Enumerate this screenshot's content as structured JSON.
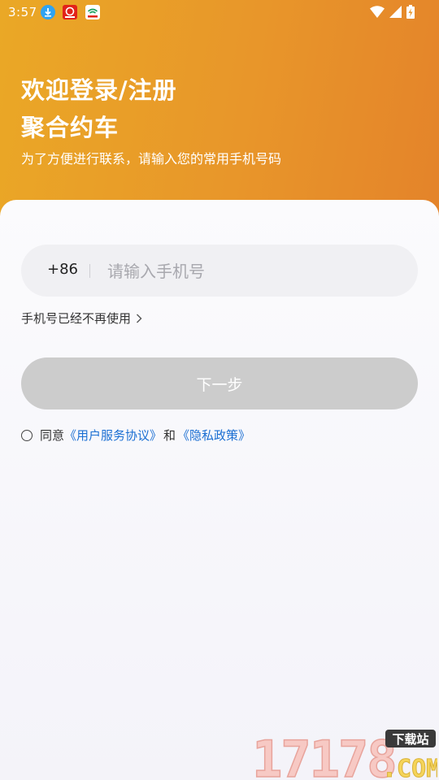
{
  "status_bar": {
    "time": "3:57"
  },
  "header": {
    "title_line1": "欢迎登录/注册",
    "title_line2": "聚合约车",
    "subtitle": "为了方便进行联系，请输入您的常用手机号码"
  },
  "form": {
    "country_code": "+86",
    "phone_placeholder": "请输入手机号",
    "phone_value": "",
    "no_longer_use_label": "手机号已经不再使用",
    "next_button_label": "下一步"
  },
  "agreement": {
    "prefix": "同意",
    "service_link": "《用户服务协议》",
    "and": "和",
    "privacy_link": "《隐私政策》",
    "checked": false
  },
  "watermark": {
    "number": "17178",
    "suffix": ".COM",
    "badge": "下载站"
  },
  "colors": {
    "header_gradient_start": "#eaa826",
    "header_gradient_end": "#e4832a",
    "link": "#1a6fd3",
    "button_disabled": "#cccccc"
  }
}
